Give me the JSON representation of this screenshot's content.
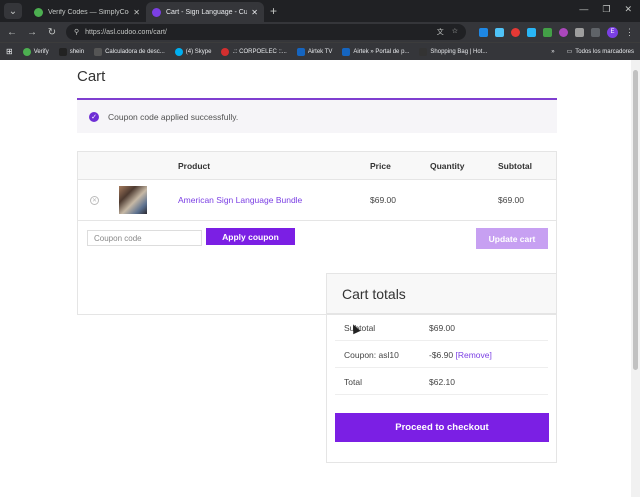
{
  "browser": {
    "tabs": [
      {
        "label": "Verify Codes — SimplyCodes",
        "color": "#4caf50",
        "active": false
      },
      {
        "label": "Cart - Sign Language - Cudoo.c",
        "color": "#7b3fe4",
        "active": true
      }
    ],
    "url": "https://asl.cudoo.com/cart/",
    "bookmarks": [
      {
        "label": "Verify",
        "color": "#4caf50"
      },
      {
        "label": "shein",
        "color": "#222"
      },
      {
        "label": "Calculadora de desc...",
        "color": "#555"
      },
      {
        "label": "(4) Skype",
        "color": "#00aff0"
      },
      {
        "label": ".:: CORPOELEC ::...",
        "color": "#d32f2f"
      },
      {
        "label": "Airtek TV",
        "color": "#1565c0"
      },
      {
        "label": "Airtek » Portal de p...",
        "color": "#1565c0"
      },
      {
        "label": "Shopping Bag | Hot...",
        "color": "#333"
      }
    ],
    "bookmarks_folder": "Todos los marcadores",
    "profile_initial": "E"
  },
  "page": {
    "title": "Cart",
    "notice": "Coupon code applied successfully.",
    "table": {
      "headers": {
        "product": "Product",
        "price": "Price",
        "quantity": "Quantity",
        "subtotal": "Subtotal"
      },
      "rows": [
        {
          "product": "American Sign Language Bundle",
          "price": "$69.00",
          "subtotal": "$69.00"
        }
      ]
    },
    "coupon_placeholder": "Coupon code",
    "apply_coupon_label": "Apply coupon",
    "update_cart_label": "Update cart",
    "totals": {
      "title": "Cart totals",
      "subtotal_label": "Subtotal",
      "subtotal_value": "$69.00",
      "coupon_label": "Coupon: asl10",
      "coupon_value": "-$6.90",
      "coupon_remove": "[Remove]",
      "total_label": "Total",
      "total_value": "$62.10",
      "checkout_label": "Proceed to checkout"
    }
  }
}
